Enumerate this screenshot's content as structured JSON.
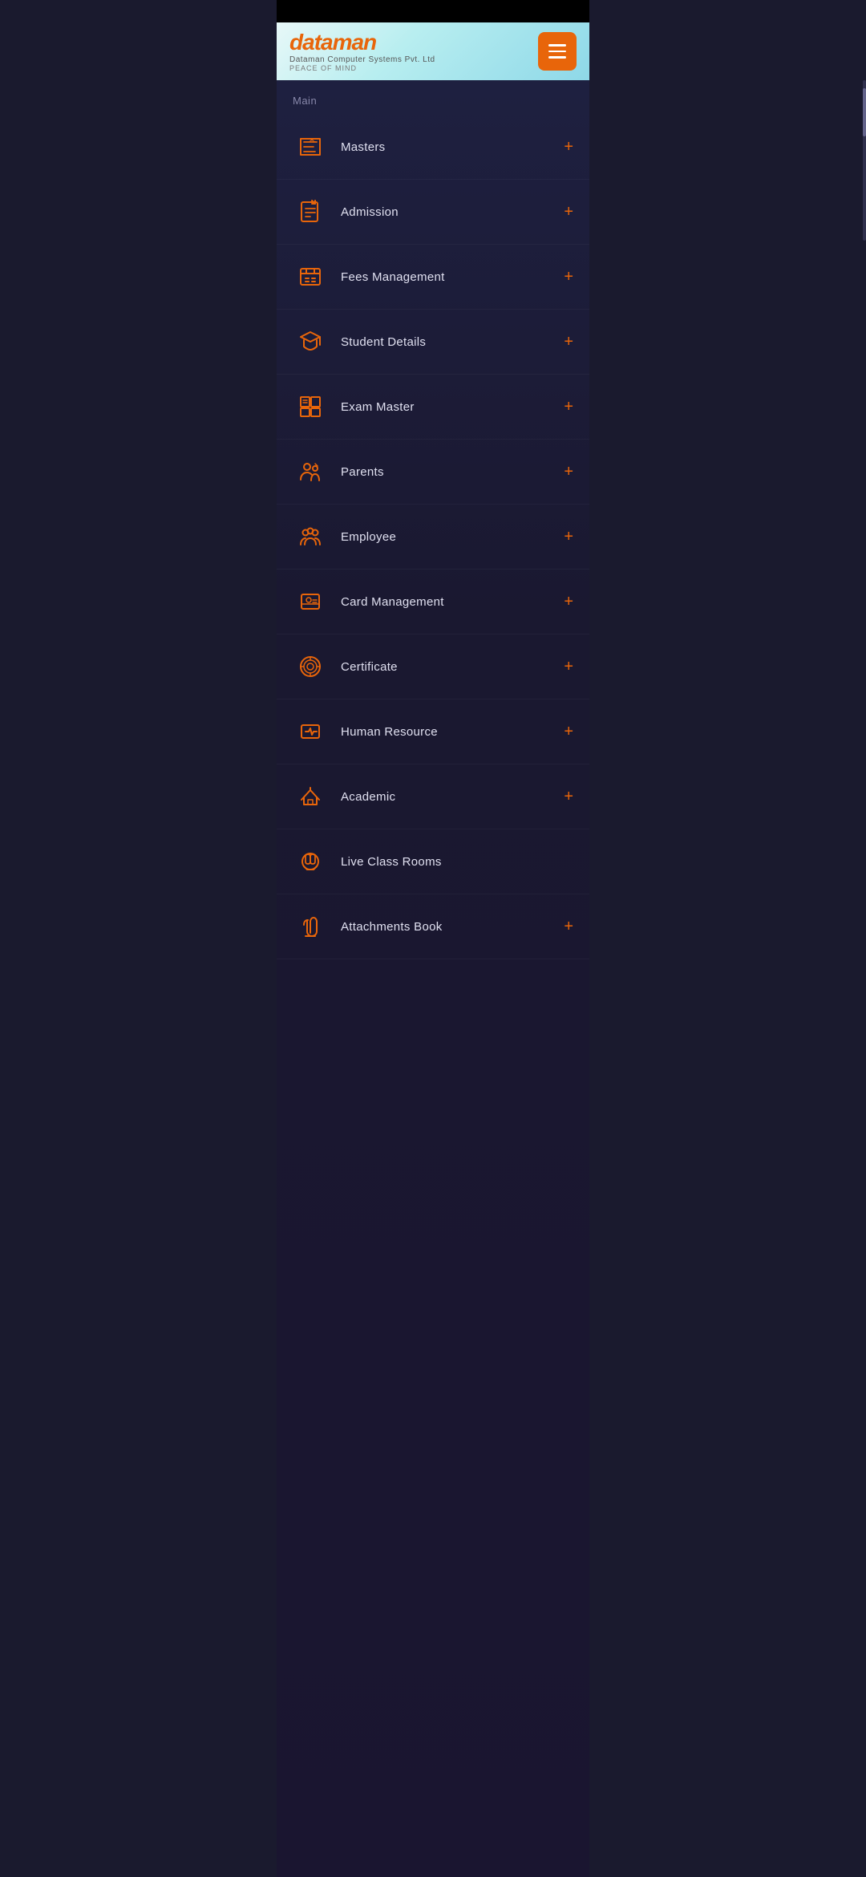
{
  "status_bar": {},
  "header": {
    "logo_brand": "dataman",
    "logo_company": "Dataman Computer Systems Pvt. Ltd",
    "logo_tagline": "PEACE OF MIND",
    "menu_button_label": "menu"
  },
  "sidebar": {
    "section_label": "Main",
    "items": [
      {
        "id": "masters",
        "label": "Masters",
        "icon": "masters-icon",
        "has_plus": true
      },
      {
        "id": "admission",
        "label": "Admission",
        "icon": "admission-icon",
        "has_plus": true
      },
      {
        "id": "fees-management",
        "label": "Fees Management",
        "icon": "fees-icon",
        "has_plus": true
      },
      {
        "id": "student-details",
        "label": "Student Details",
        "icon": "student-icon",
        "has_plus": true
      },
      {
        "id": "exam-master",
        "label": "Exam Master",
        "icon": "exam-icon",
        "has_plus": true
      },
      {
        "id": "parents",
        "label": "Parents",
        "icon": "parents-icon",
        "has_plus": true
      },
      {
        "id": "employee",
        "label": "Employee",
        "icon": "employee-icon",
        "has_plus": true
      },
      {
        "id": "card-management",
        "label": "Card Management",
        "icon": "card-icon",
        "has_plus": true
      },
      {
        "id": "certificate",
        "label": "Certificate",
        "icon": "certificate-icon",
        "has_plus": true
      },
      {
        "id": "human-resource",
        "label": "Human Resource",
        "icon": "hr-icon",
        "has_plus": true
      },
      {
        "id": "academic",
        "label": "Academic",
        "icon": "academic-icon",
        "has_plus": true
      },
      {
        "id": "live-class-rooms",
        "label": "Live Class Rooms",
        "icon": "live-class-icon",
        "has_plus": false
      },
      {
        "id": "attachments-book",
        "label": "Attachments Book",
        "icon": "attachments-icon",
        "has_plus": true
      }
    ],
    "plus_symbol": "+"
  },
  "colors": {
    "accent": "#e8650a",
    "background": "#1a1830",
    "text_primary": "#e0e0f0",
    "text_muted": "#8888aa"
  }
}
